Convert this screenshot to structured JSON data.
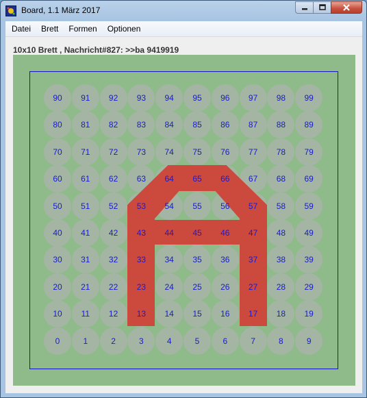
{
  "window": {
    "title": "Board, 1.1 März 2017",
    "icons": {
      "app": "board-app-icon",
      "minimize": "minimize-icon",
      "maximize": "maximize-icon",
      "close": "close-icon"
    }
  },
  "menu": {
    "items": [
      "Datei",
      "Brett",
      "Formen",
      "Optionen"
    ]
  },
  "status": {
    "text": "10x10 Brett , Nachricht#827: >>ba 9419919"
  },
  "board": {
    "rows": 10,
    "cols": 10,
    "numbers_top_to_bottom": [
      [
        "90",
        "91",
        "92",
        "93",
        "94",
        "95",
        "96",
        "97",
        "98",
        "99"
      ],
      [
        "80",
        "81",
        "82",
        "83",
        "84",
        "85",
        "86",
        "87",
        "88",
        "89"
      ],
      [
        "70",
        "71",
        "72",
        "73",
        "74",
        "75",
        "76",
        "77",
        "78",
        "79"
      ],
      [
        "60",
        "61",
        "62",
        "63",
        "64",
        "65",
        "66",
        "67",
        "68",
        "69"
      ],
      [
        "50",
        "51",
        "52",
        "53",
        "54",
        "55",
        "56",
        "57",
        "58",
        "59"
      ],
      [
        "40",
        "41",
        "42",
        "43",
        "44",
        "45",
        "46",
        "47",
        "48",
        "49"
      ],
      [
        "30",
        "31",
        "32",
        "33",
        "34",
        "35",
        "36",
        "37",
        "38",
        "39"
      ],
      [
        "20",
        "21",
        "22",
        "23",
        "24",
        "25",
        "26",
        "27",
        "28",
        "29"
      ],
      [
        "10",
        "11",
        "12",
        "13",
        "14",
        "15",
        "16",
        "17",
        "18",
        "19"
      ],
      [
        "0",
        "1",
        "2",
        "3",
        "4",
        "5",
        "6",
        "7",
        "8",
        "9"
      ]
    ],
    "highlighted_cells": [
      "13",
      "23",
      "33",
      "43",
      "53",
      "64",
      "65",
      "66",
      "57",
      "47",
      "37",
      "27",
      "17",
      "44",
      "45",
      "46",
      "54",
      "56"
    ],
    "colors": {
      "board_bg": "#8fbb8b",
      "cell": "#a4b5a4",
      "number": "#1a1acc",
      "frame": "#1515cc",
      "highlight": "#cc4a3d"
    }
  }
}
